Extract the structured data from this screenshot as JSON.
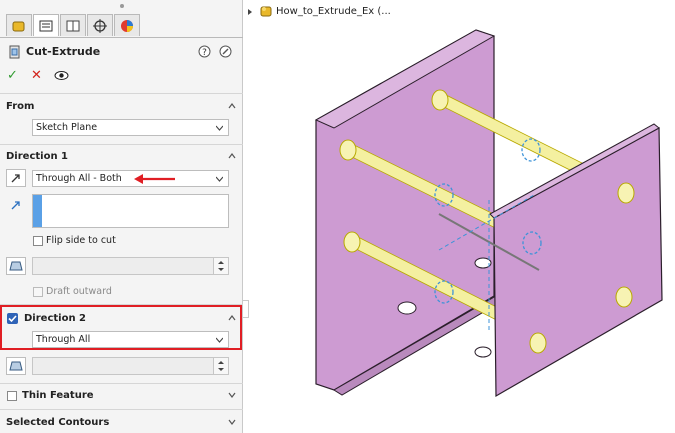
{
  "panel": {
    "tabs": [
      "feature-manager-icon",
      "property-manager-icon",
      "configuration-manager-icon",
      "dimxpert-icon",
      "display-manager-icon"
    ],
    "title": "Cut-Extrude",
    "help_icon": "help-icon",
    "pin_icon": "pushpin-icon",
    "actions": {
      "ok": "✓",
      "cancel": "✕",
      "preview": "eye-icon"
    },
    "from": {
      "header": "From",
      "value": "Sketch Plane"
    },
    "direction1": {
      "header": "Direction 1",
      "end_condition": "Through All - Both",
      "flip_label": "Flip side to cut",
      "draft_label": "Draft outward"
    },
    "direction2": {
      "header": "Direction 2",
      "checked": true,
      "end_condition": "Through All"
    },
    "thin_feature": {
      "header": "Thin Feature",
      "checked": false
    },
    "selected_contours": {
      "header": "Selected Contours"
    }
  },
  "tree": {
    "part_name": "How_to_Extrude_Ex (..."
  },
  "colors": {
    "highlight_red": "#e01e24",
    "part_fill": "#cd9bd2",
    "cylinder_fill": "#f4f0a0",
    "selection_blue": "#3d93d8"
  }
}
